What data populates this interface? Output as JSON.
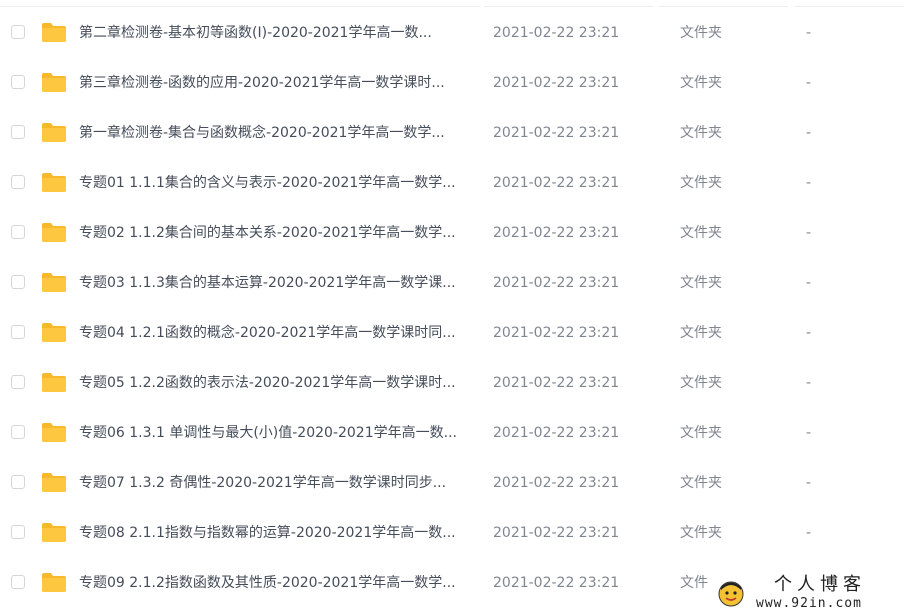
{
  "file_list": {
    "rows": [
      {
        "name": "第二章检测卷-基本初等函数(Ⅰ)-2020-2021学年高一数...",
        "date": "2021-02-22 23:21",
        "type": "文件夹",
        "size": "-"
      },
      {
        "name": "第三章检测卷-函数的应用-2020-2021学年高一数学课时...",
        "date": "2021-02-22 23:21",
        "type": "文件夹",
        "size": "-"
      },
      {
        "name": "第一章检测卷-集合与函数概念-2020-2021学年高一数学...",
        "date": "2021-02-22 23:21",
        "type": "文件夹",
        "size": "-"
      },
      {
        "name": "专题01 1.1.1集合的含义与表示-2020-2021学年高一数学...",
        "date": "2021-02-22 23:21",
        "type": "文件夹",
        "size": "-"
      },
      {
        "name": "专题02 1.1.2集合间的基本关系-2020-2021学年高一数学...",
        "date": "2021-02-22 23:21",
        "type": "文件夹",
        "size": "-"
      },
      {
        "name": "专题03 1.1.3集合的基本运算-2020-2021学年高一数学课...",
        "date": "2021-02-22 23:21",
        "type": "文件夹",
        "size": "-"
      },
      {
        "name": "专题04 1.2.1函数的概念-2020-2021学年高一数学课时同...",
        "date": "2021-02-22 23:21",
        "type": "文件夹",
        "size": "-"
      },
      {
        "name": "专题05 1.2.2函数的表示法-2020-2021学年高一数学课时...",
        "date": "2021-02-22 23:21",
        "type": "文件夹",
        "size": "-"
      },
      {
        "name": "专题06 1.3.1 单调性与最大(小)值-2020-2021学年高一数...",
        "date": "2021-02-22 23:21",
        "type": "文件夹",
        "size": "-"
      },
      {
        "name": "专题07 1.3.2 奇偶性-2020-2021学年高一数学课时同步...",
        "date": "2021-02-22 23:21",
        "type": "文件夹",
        "size": "-"
      },
      {
        "name": "专题08 2.1.1指数与指数幂的运算-2020-2021学年高一数...",
        "date": "2021-02-22 23:21",
        "type": "文件夹",
        "size": "-"
      },
      {
        "name": "专题09 2.1.2指数函数及其性质-2020-2021学年高一数学...",
        "date": "2021-02-22 23:21",
        "type": "文件",
        "size": ""
      }
    ]
  },
  "watermark": {
    "title": "个人博客",
    "url": "www.92in.com"
  },
  "icons": {
    "row_icon": "folder-icon",
    "watermark_logo": "smiley-logo-icon"
  },
  "colors": {
    "folder_body": "#fdc83f",
    "folder_tab": "#f7b82b",
    "name_text": "#454d5a",
    "meta_text": "#80868f",
    "checkbox_border": "#d6d6d6"
  }
}
